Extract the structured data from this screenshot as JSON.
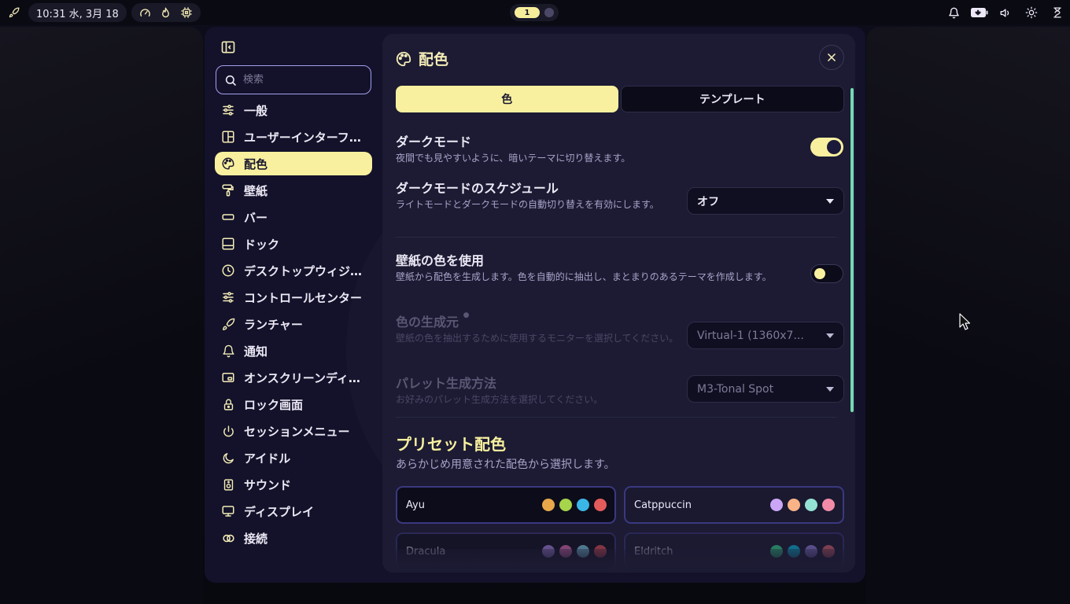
{
  "topbar": {
    "clock": "10:31 水, 3月 18",
    "workspace_active": "1"
  },
  "sidebar": {
    "search_placeholder": "検索",
    "items": [
      {
        "label": "一般",
        "icon": "sliders-icon"
      },
      {
        "label": "ユーザーインターフェース",
        "icon": "layout-icon"
      },
      {
        "label": "配色",
        "icon": "palette-icon"
      },
      {
        "label": "壁紙",
        "icon": "paint-roller-icon"
      },
      {
        "label": "バー",
        "icon": "bar-icon"
      },
      {
        "label": "ドック",
        "icon": "dock-icon"
      },
      {
        "label": "デスクトップウィジェット",
        "icon": "clock-icon"
      },
      {
        "label": "コントロールセンター",
        "icon": "sliders-icon"
      },
      {
        "label": "ランチャー",
        "icon": "rocket-icon"
      },
      {
        "label": "通知",
        "icon": "bell-icon"
      },
      {
        "label": "オンスクリーンディスプレイ",
        "icon": "osd-icon"
      },
      {
        "label": "ロック画面",
        "icon": "lock-icon"
      },
      {
        "label": "セッションメニュー",
        "icon": "power-icon"
      },
      {
        "label": "アイドル",
        "icon": "moon-icon"
      },
      {
        "label": "サウンド",
        "icon": "speaker-icon"
      },
      {
        "label": "ディスプレイ",
        "icon": "monitor-icon"
      },
      {
        "label": "接続",
        "icon": "link-icon"
      }
    ]
  },
  "content": {
    "title": "配色",
    "tabs": [
      {
        "label": "色",
        "active": true
      },
      {
        "label": "テンプレート",
        "active": false
      }
    ],
    "dark_mode": {
      "title": "ダークモード",
      "desc": "夜間でも見やすいように、暗いテーマに切り替えます。",
      "enabled": true
    },
    "dark_schedule": {
      "title": "ダークモードのスケジュール",
      "desc": "ライトモードとダークモードの自動切り替えを有効にします。",
      "value": "オフ"
    },
    "wallpaper_colors": {
      "title": "壁紙の色を使用",
      "desc": "壁紙から配色を生成します。色を自動的に抽出し、まとまりのあるテーマを作成します。",
      "enabled": false
    },
    "color_source": {
      "title": "色の生成元",
      "desc": "壁紙の色を抽出するために使用するモニターを選択してください。",
      "value": "Virtual-1 (1360x7..."
    },
    "palette_method": {
      "title": "パレット生成方法",
      "desc": "お好みのパレット生成方法を選択してください。",
      "value": "M3-Tonal Spot"
    },
    "presets": {
      "title": "プリセット配色",
      "desc": "あらかじめ用意された配色から選択します。",
      "items": [
        {
          "name": "Ayu",
          "colors": [
            "#e8a84a",
            "#a6d44a",
            "#3ab7e6",
            "#e45b5b"
          ]
        },
        {
          "name": "Catppuccin",
          "colors": [
            "#cba6f7",
            "#fab387",
            "#94e2d5",
            "#f38ba8"
          ]
        },
        {
          "name": "Dracula",
          "colors": [
            "#bd93f9",
            "#ff79c6",
            "#8be9fd",
            "#ff5555"
          ]
        },
        {
          "name": "Eldritch",
          "colors": [
            "#37f499",
            "#04d1f9",
            "#a48cf2",
            "#f16c75"
          ]
        }
      ]
    }
  },
  "colors": {
    "accent": "#f8f09f",
    "surface": "#1c1b33",
    "window": "#13122a",
    "scrollbar": "#77d9b3"
  }
}
